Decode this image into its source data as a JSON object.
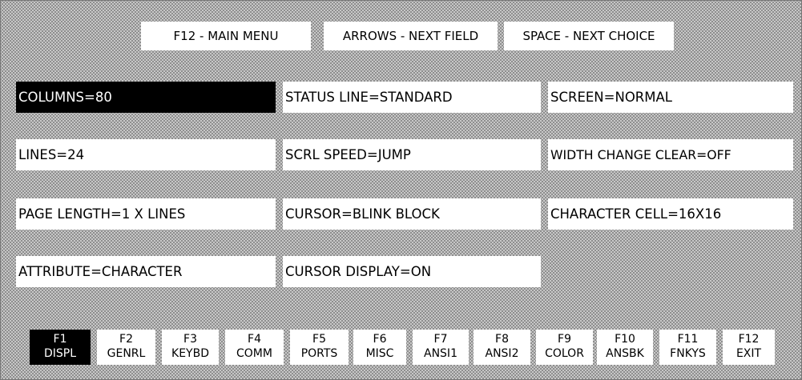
{
  "hints": {
    "main_menu": "F12 - MAIN MENU",
    "next_field": "ARROWS - NEXT FIELD",
    "next_choice": "SPACE - NEXT CHOICE"
  },
  "fields": {
    "columns": "COLUMNS=80",
    "status_line": "STATUS LINE=STANDARD",
    "screen": "SCREEN=NORMAL",
    "lines": "LINES=24",
    "scrl_speed": "SCRL SPEED=JUMP",
    "width_change_clear": "WIDTH CHANGE CLEAR=OFF",
    "page_length": "PAGE LENGTH=1 X LINES",
    "cursor": "CURSOR=BLINK BLOCK",
    "character_cell": "CHARACTER CELL=16X16",
    "attribute": "ATTRIBUTE=CHARACTER",
    "cursor_display": "CURSOR DISPLAY=ON"
  },
  "selected_field": "columns",
  "fkeys": [
    {
      "key": "F1",
      "label": "DISPL",
      "active": true
    },
    {
      "key": "F2",
      "label": "GENRL",
      "active": false
    },
    {
      "key": "F3",
      "label": "KEYBD",
      "active": false
    },
    {
      "key": "F4",
      "label": "COMM",
      "active": false
    },
    {
      "key": "F5",
      "label": "PORTS",
      "active": false
    },
    {
      "key": "F6",
      "label": "MISC",
      "active": false
    },
    {
      "key": "F7",
      "label": "ANSI1",
      "active": false
    },
    {
      "key": "F8",
      "label": "ANSI2",
      "active": false
    },
    {
      "key": "F9",
      "label": "COLOR",
      "active": false
    },
    {
      "key": "F10",
      "label": "ANSBK",
      "active": false
    },
    {
      "key": "F11",
      "label": "FNKYS",
      "active": false
    },
    {
      "key": "F12",
      "label": "EXIT",
      "active": false
    }
  ],
  "colors": {
    "selected_bg": "#000000",
    "selected_fg": "#ffffff",
    "field_bg": "#ffffff",
    "dither_dark": "#8e8e8e",
    "dither_light": "#c8c8c8"
  }
}
